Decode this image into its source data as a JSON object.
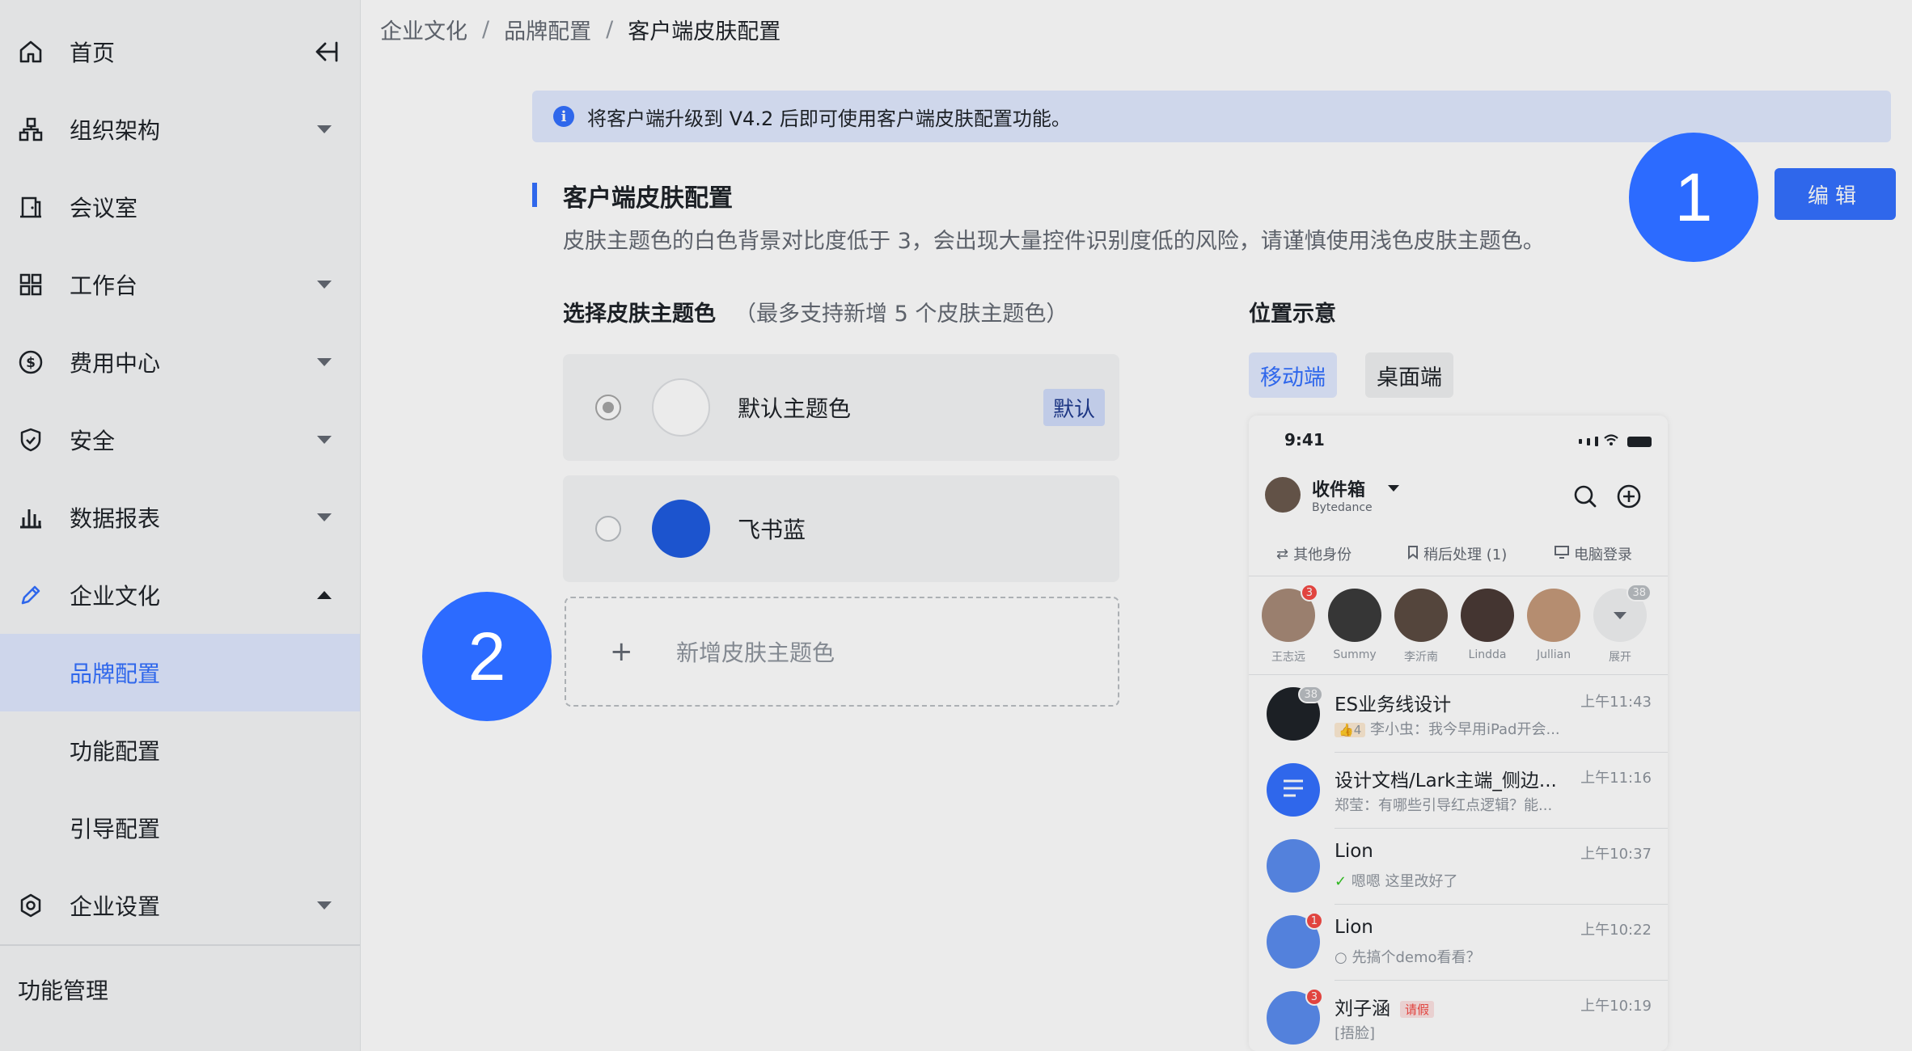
{
  "sidebar": {
    "home_label": "首页",
    "items": [
      {
        "label": "组织架构"
      },
      {
        "label": "会议室"
      },
      {
        "label": "工作台"
      },
      {
        "label": "费用中心"
      },
      {
        "label": "安全"
      },
      {
        "label": "数据报表"
      },
      {
        "label": "企业文化"
      }
    ],
    "sub_items": [
      {
        "label": "品牌配置",
        "active": true
      },
      {
        "label": "功能配置"
      },
      {
        "label": "引导配置"
      }
    ],
    "enterprise_settings": "企业设置",
    "section_label": "功能管理"
  },
  "breadcrumb": {
    "items": [
      "企业文化",
      "品牌配置"
    ],
    "separator": "/",
    "current": "客户端皮肤配置"
  },
  "notice": {
    "text": "将客户端升级到 V4.2 后即可使用客户端皮肤配置功能。"
  },
  "section": {
    "title": "客户端皮肤配置",
    "description": "皮肤主题色的白色背景对比度低于 3，会出现大量控件识别度低的风险，请谨慎使用浅色皮肤主题色。",
    "edit_label": "编辑"
  },
  "theme_select": {
    "title": "选择皮肤主题色",
    "hint": "（最多支持新增 5 个皮肤主题色）",
    "themes": [
      {
        "name": "默认主题色",
        "color": "#ffffff",
        "checked": true,
        "tag": "默认"
      },
      {
        "name": "飞书蓝",
        "color": "#1f5ce0",
        "checked": false
      }
    ],
    "add_label": "新增皮肤主题色",
    "add_icon": "+"
  },
  "position": {
    "title": "位置示意",
    "tabs": [
      "移动端",
      "桌面端"
    ],
    "active_tab": "移动端"
  },
  "phone": {
    "time": "9:41",
    "inbox": "收件箱",
    "org": "Bytedance",
    "quick": [
      "其他身份",
      "稍后处理 (1)",
      "电脑登录"
    ],
    "stories": [
      {
        "name": "王志远",
        "badge": "3"
      },
      {
        "name": "Summy"
      },
      {
        "name": "李沂南"
      },
      {
        "name": "Lindda"
      },
      {
        "name": "Jullian"
      },
      {
        "name": "展开",
        "badge": "38"
      }
    ],
    "chats": [
      {
        "title": "ES业务线设计",
        "sub_count": "4",
        "sub": "李小虫：我今早用iPad开会...",
        "time": "上午11:43",
        "badge": "38"
      },
      {
        "title": "设计文档/Lark主端_侧边...",
        "sub": "郑莹：有哪些引导红点逻辑？能...",
        "time": "上午11:16"
      },
      {
        "title": "Lion",
        "sub": "嗯嗯 这里改好了",
        "time": "上午10:37"
      },
      {
        "title": "Lion",
        "sub": "先搞个demo看看？",
        "time": "上午10:22",
        "badge": "1"
      },
      {
        "title": "刘子涵",
        "tag": "请假",
        "sub": "[捂脸]",
        "time": "上午10:19",
        "badge": "3"
      }
    ]
  },
  "steps": [
    "1",
    "2"
  ],
  "colors": {
    "accent": "#3370ff",
    "step_marker": "#2c6bff",
    "feishu_blue": "#1f5ce0"
  }
}
